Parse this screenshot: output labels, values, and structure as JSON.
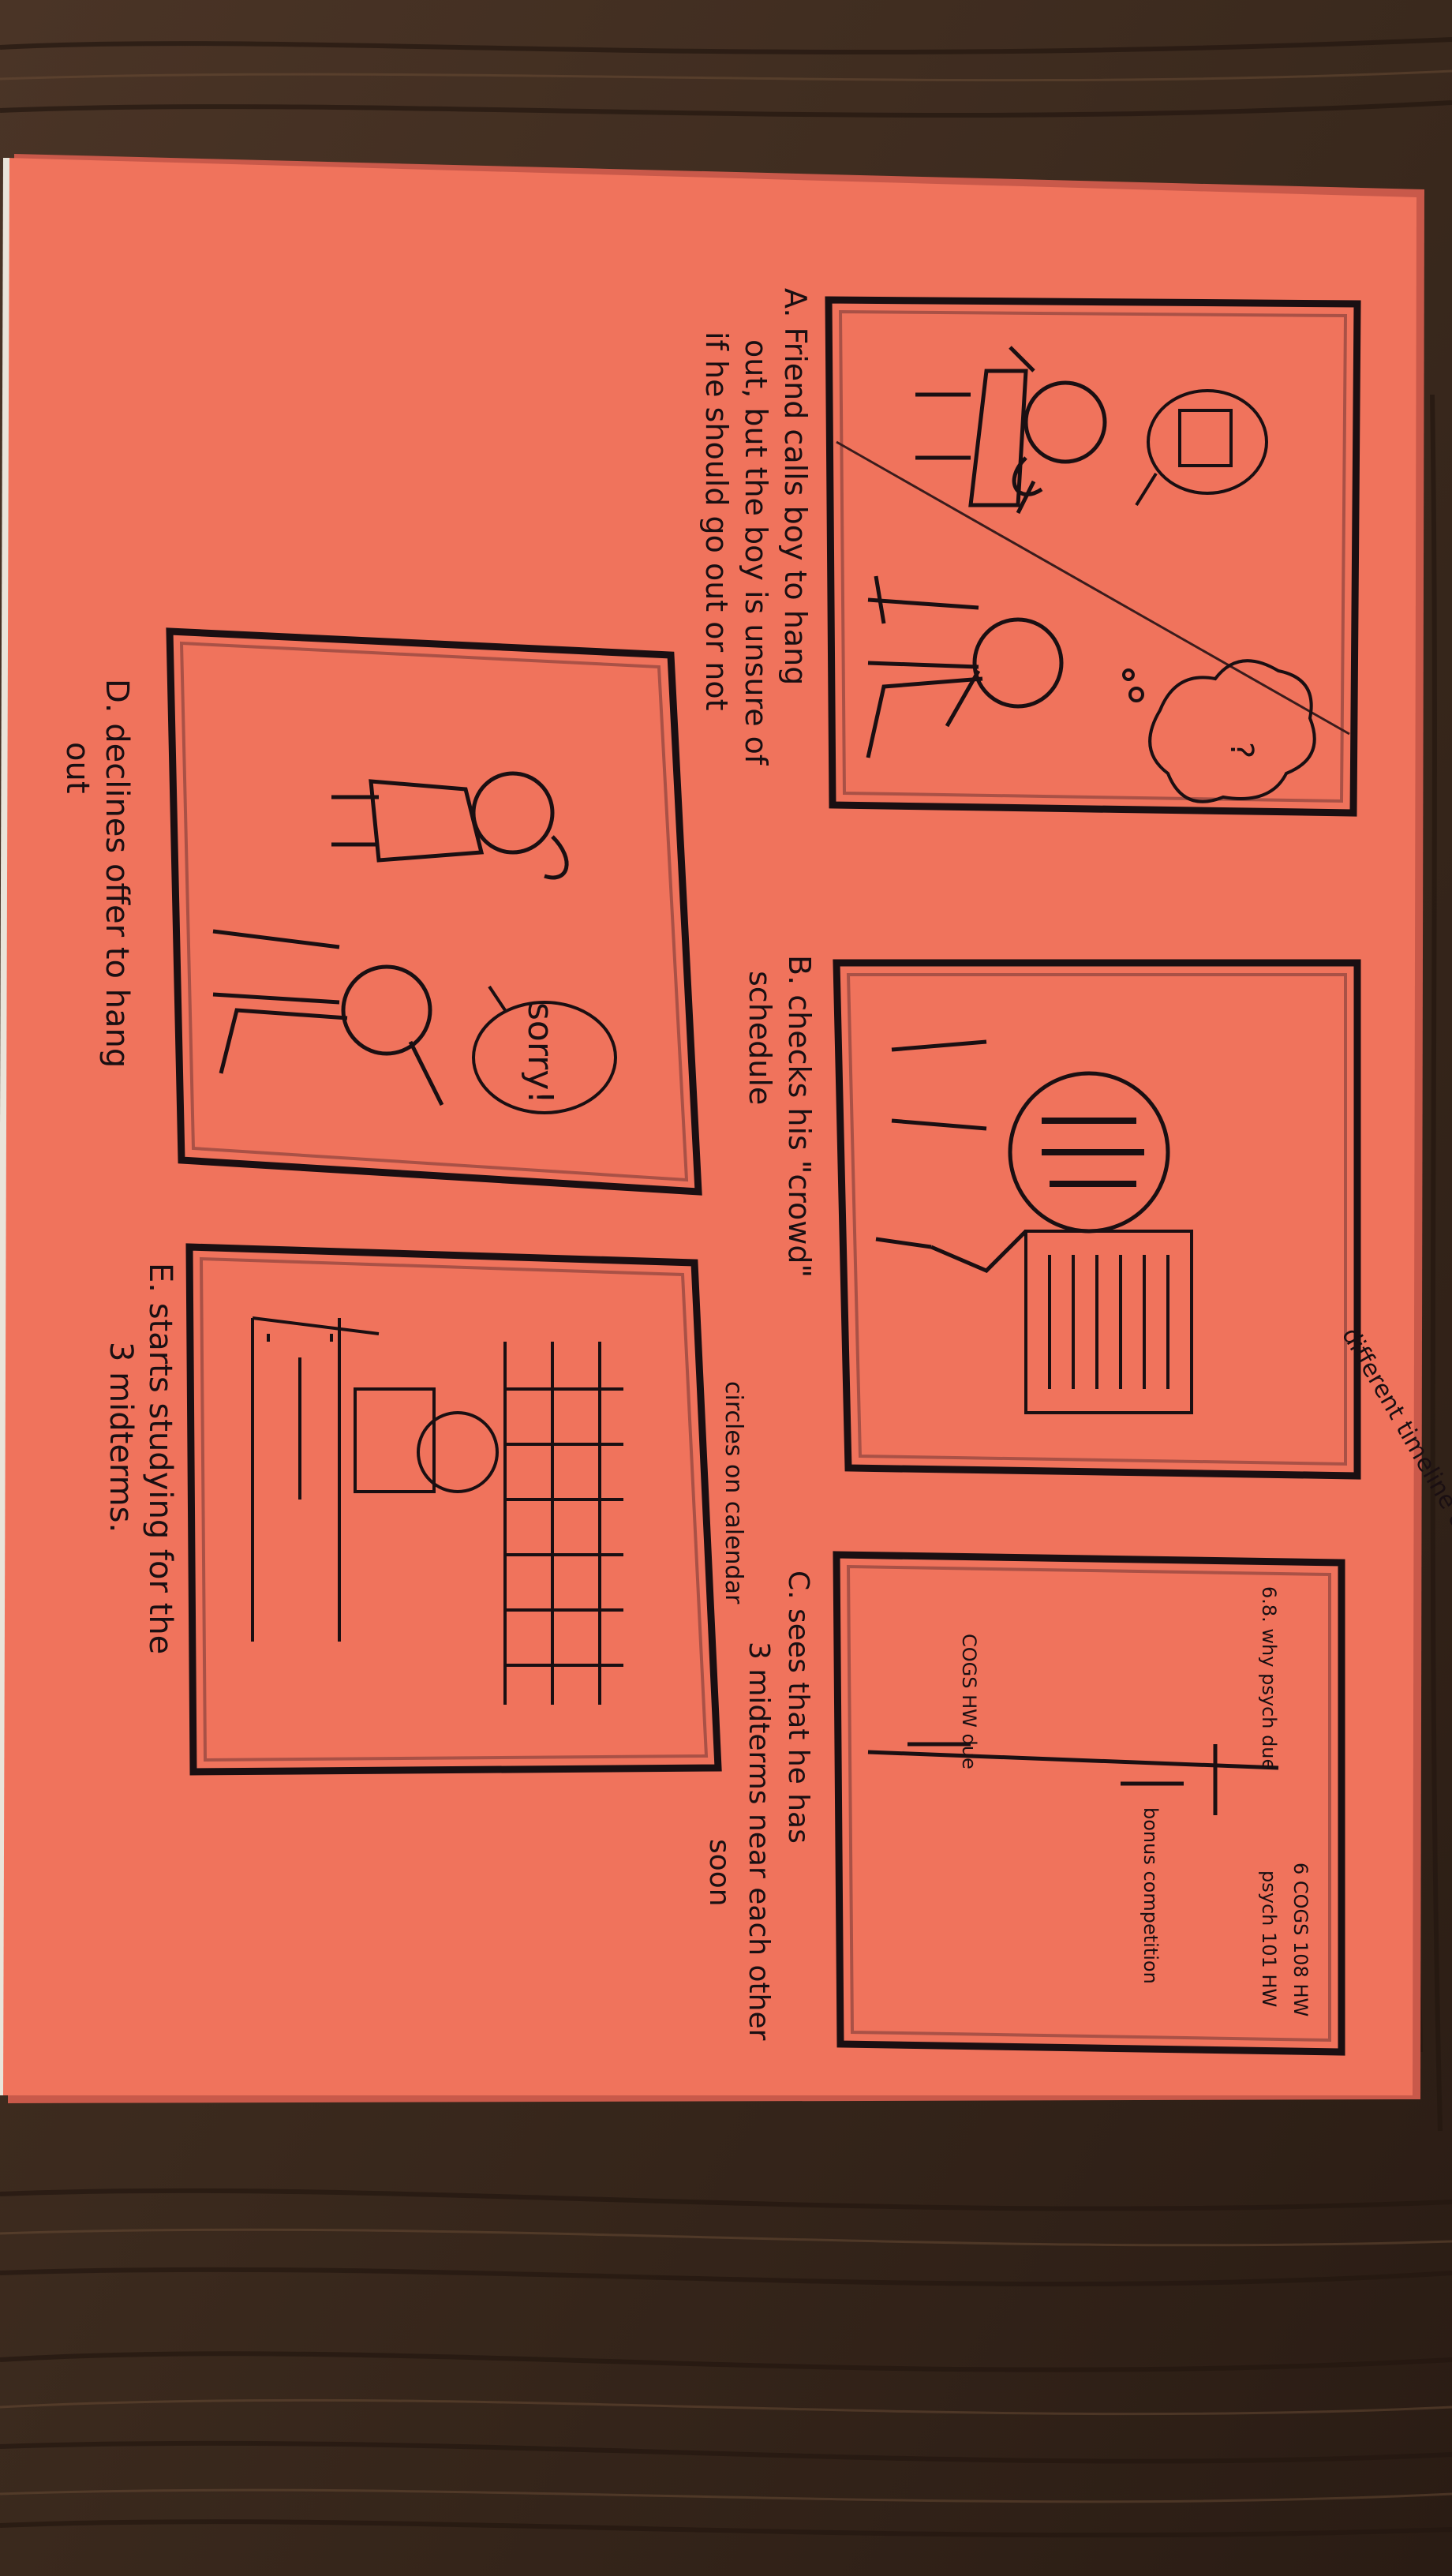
{
  "colors": {
    "wood_dark": "#2f2119",
    "wood_mid": "#4a3426",
    "wood_light": "#6b4d36",
    "paper": "#f0735c",
    "paper_shadow": "#d9604c",
    "ink": "#1a0f12"
  },
  "panels": [
    {
      "id": "A",
      "caption_lines": [
        "A. Friend calls boy to hang",
        "out, but the boy is unsure of",
        "if he should go out or not"
      ],
      "bubbles": [
        "?",
        "..."
      ]
    },
    {
      "id": "B",
      "caption_lines": [
        "B. checks his \"crowd\"",
        "schedule"
      ],
      "bubbles": [],
      "side_note": "different timeline of stuff"
    },
    {
      "id": "C",
      "caption_lines": [
        "C. sees that he has",
        "3 midterms near each other",
        "soon"
      ],
      "bubbles": [],
      "side_note": "circles on calendar",
      "calendar_labels": [
        "6.8. why psych due",
        "COGS HW due",
        "6 COGS 108 HW",
        "psych 101 HW",
        "bonus competition"
      ]
    },
    {
      "id": "D",
      "caption_lines": [
        "D. declines offer to hang",
        "out"
      ],
      "bubbles": [
        "sorry!"
      ]
    },
    {
      "id": "E",
      "caption_lines": [
        "E. starts studying for the",
        "3 midterms."
      ],
      "bubbles": []
    }
  ]
}
